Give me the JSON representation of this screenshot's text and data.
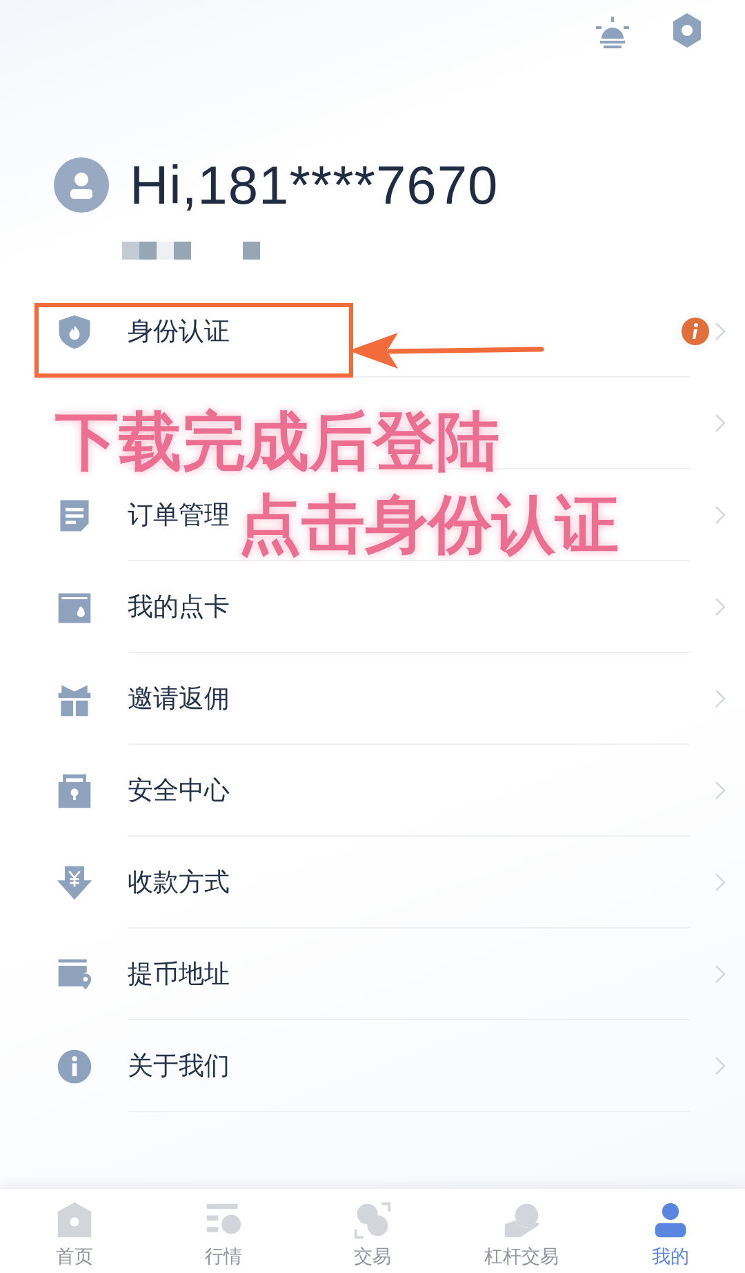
{
  "user": {
    "greeting": "Hi,181****7670"
  },
  "menu": [
    {
      "label": "身份认证",
      "alert": true,
      "highlighted": true
    },
    {
      "alert": false,
      "highlighted": false
    },
    {
      "label": "订单管理",
      "alert": false,
      "highlighted": false
    },
    {
      "label": "我的点卡",
      "alert": false,
      "highlighted": false
    },
    {
      "label": "邀请返佣",
      "alert": false,
      "highlighted": false
    },
    {
      "label": "安全中心",
      "alert": false,
      "highlighted": false
    },
    {
      "label": "收款方式",
      "alert": false,
      "highlighted": false
    },
    {
      "label": "提币地址",
      "alert": false,
      "highlighted": false
    },
    {
      "label": "关于我们",
      "alert": false,
      "highlighted": false
    }
  ],
  "annotation": {
    "lines": [
      "下载完成后登陆",
      "点击身份认证"
    ]
  },
  "tab_bar": [
    {
      "label": "首页",
      "selected": false
    },
    {
      "label": "行情",
      "selected": false
    },
    {
      "label": "交易",
      "selected": false
    },
    {
      "label": "杠杆交易",
      "selected": false
    },
    {
      "label": "我的",
      "selected": true
    }
  ]
}
